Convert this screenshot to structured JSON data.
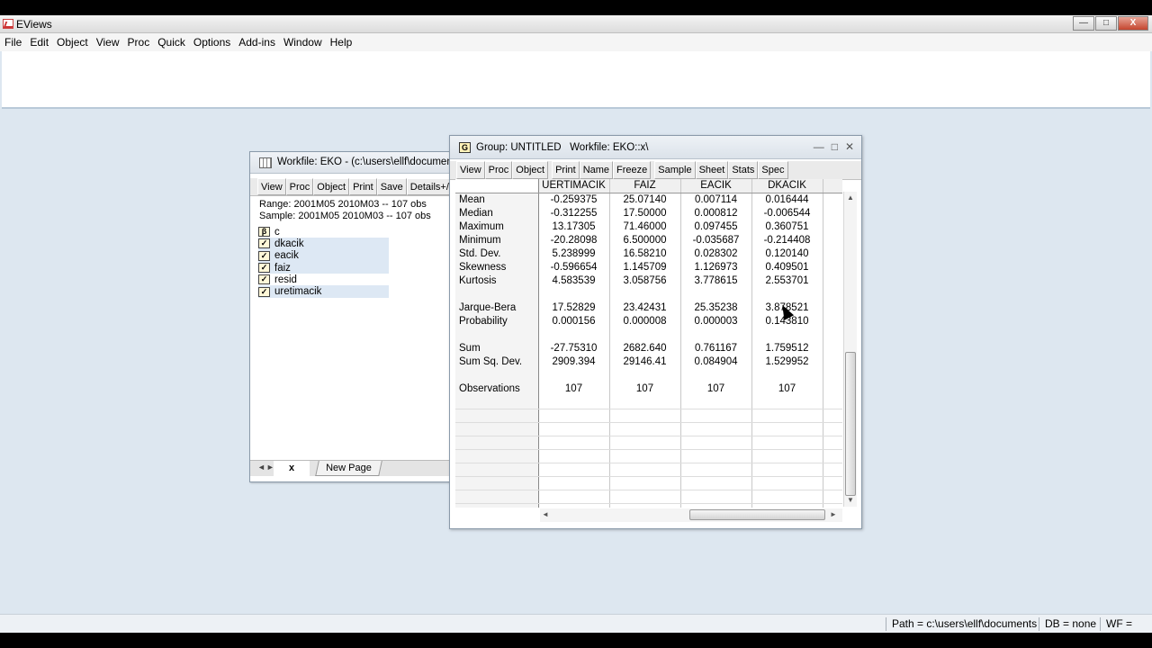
{
  "app": {
    "title": "EViews",
    "menu": [
      "File",
      "Edit",
      "Object",
      "View",
      "Proc",
      "Quick",
      "Options",
      "Add-ins",
      "Window",
      "Help"
    ],
    "window_controls": {
      "minimize": "—",
      "maximize": "□",
      "close": "X"
    }
  },
  "workfile": {
    "title": "Workfile: EKO - (c:\\users\\ellf\\documen",
    "toolbar": [
      "View",
      "Proc",
      "Object",
      "Print",
      "Save",
      "Details+/-"
    ],
    "range": "Range:  2001M05 2010M03  --  107 obs",
    "sample": "Sample: 2001M05 2010M03  --  107 obs",
    "objects": [
      {
        "name": "c",
        "icon": "coef-icon",
        "selected": false
      },
      {
        "name": "dkacik",
        "icon": "series-icon",
        "selected": true
      },
      {
        "name": "eacik",
        "icon": "series-icon",
        "selected": true
      },
      {
        "name": "faiz",
        "icon": "series-icon",
        "selected": true
      },
      {
        "name": "resid",
        "icon": "series-icon",
        "selected": false
      },
      {
        "name": "uretimacik",
        "icon": "series-icon",
        "selected": true
      }
    ],
    "page_arrows": "◄►",
    "page_tab_x": "x",
    "new_page": "New Page"
  },
  "group": {
    "icon_letter": "G",
    "title": "Group: UNTITLED   Workfile: EKO::x\\",
    "controls": {
      "minimize": "—",
      "maximize": "□",
      "close": "✕"
    },
    "toolbar": [
      "View",
      "Proc",
      "Object",
      "Print",
      "Name",
      "Freeze",
      "Sample",
      "Sheet",
      "Stats",
      "Spec"
    ],
    "columns": [
      "UERTIMACIK",
      "FAIZ",
      "EACIK",
      "DKACIK"
    ],
    "rows": [
      {
        "label": "Mean",
        "values": [
          "-0.259375",
          "25.07140",
          "0.007114",
          "0.016444"
        ]
      },
      {
        "label": "Median",
        "values": [
          "-0.312255",
          "17.50000",
          "0.000812",
          "-0.006544"
        ]
      },
      {
        "label": "Maximum",
        "values": [
          "13.17305",
          "71.46000",
          "0.097455",
          "0.360751"
        ]
      },
      {
        "label": "Minimum",
        "values": [
          "-20.28098",
          "6.500000",
          "-0.035687",
          "-0.214408"
        ]
      },
      {
        "label": "Std. Dev.",
        "values": [
          "5.238999",
          "16.58210",
          "0.028302",
          "0.120140"
        ]
      },
      {
        "label": "Skewness",
        "values": [
          "-0.596654",
          "1.145709",
          "1.126973",
          "0.409501"
        ]
      },
      {
        "label": "Kurtosis",
        "values": [
          "4.583539",
          "3.058756",
          "3.778615",
          "2.553701"
        ]
      },
      {
        "label": "",
        "values": [
          "",
          "",
          "",
          ""
        ]
      },
      {
        "label": "Jarque-Bera",
        "values": [
          "17.52829",
          "23.42431",
          "25.35238",
          "3.878521"
        ]
      },
      {
        "label": "Probability",
        "values": [
          "0.000156",
          "0.000008",
          "0.000003",
          "0.143810"
        ]
      },
      {
        "label": "",
        "values": [
          "",
          "",
          "",
          ""
        ]
      },
      {
        "label": "Sum",
        "values": [
          "-27.75310",
          "2682.640",
          "0.761167",
          "1.759512"
        ]
      },
      {
        "label": "Sum Sq. Dev.",
        "values": [
          "2909.394",
          "29146.41",
          "0.084904",
          "1.529952"
        ]
      },
      {
        "label": "",
        "values": [
          "",
          "",
          "",
          ""
        ]
      },
      {
        "label": "Observations",
        "values": [
          "107",
          "107",
          "107",
          "107"
        ]
      }
    ]
  },
  "status": {
    "path": "Path = c:\\users\\ellf\\documents",
    "db": "DB = none",
    "wf": "WF = eko"
  },
  "colors": {
    "desktop": "#dde7f0",
    "selection": "#dde8f4"
  }
}
